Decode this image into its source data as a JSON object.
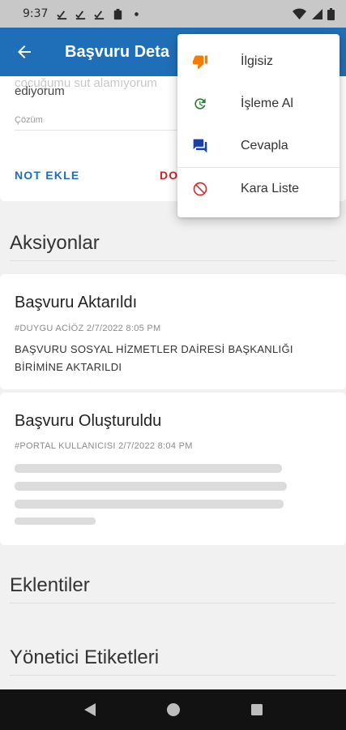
{
  "status_bar": {
    "time": "9:37"
  },
  "app_bar": {
    "title": "Başvuru Deta"
  },
  "top_card": {
    "faded_text": "çocuğumu sut alamıyorum",
    "description_end": "ediyorum",
    "solution_label": "Çözüm",
    "note_button": "NOT EKLE",
    "red_button": "DO"
  },
  "sections": {
    "actions": "Aksiyonlar",
    "attachments": "Eklentiler",
    "admin_tags": "Yönetici Etiketleri"
  },
  "actions": [
    {
      "title": "Başvuru Aktarıldı",
      "meta": "#DUYGU ACİÖZ  2/7/2022 8:05 PM",
      "body": "BAŞVURU SOSYAL HİZMETLER DAİRESİ BAŞKANLIĞI BİRİMİNE AKTARILDI"
    },
    {
      "title": "Başvuru Oluşturuldu",
      "meta": "#PORTAL KULLANICISI  2/7/2022 8:04 PM"
    }
  ],
  "menu": {
    "items": [
      {
        "label": "İlgisiz",
        "icon": "thumbs-down-icon",
        "color": "#f57c00"
      },
      {
        "label": "İşleme Al",
        "icon": "refresh-clock-icon",
        "color": "#2e7d32"
      },
      {
        "label": "Cevapla",
        "icon": "chat-icon",
        "color": "#1a3fa8"
      },
      {
        "label": "Kara Liste",
        "icon": "block-icon",
        "color": "#d32f2f"
      }
    ]
  },
  "colors": {
    "primary": "#1f6fb8",
    "danger": "#c62828"
  }
}
